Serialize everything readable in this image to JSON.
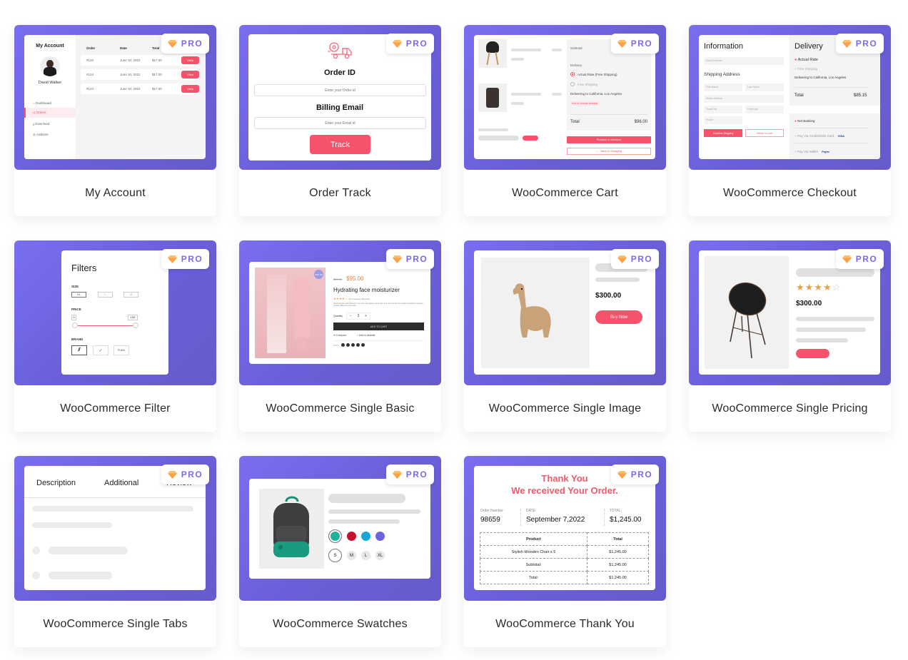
{
  "badge_label": "PRO",
  "colors": {
    "accent": "#7b6be8",
    "thumb_bg": "#7066e0",
    "red": "#f5526b",
    "star": "#e5a04a"
  },
  "cards": [
    {
      "title": "My Account",
      "preview": {
        "heading": "My Account",
        "user_name": "David Walker",
        "menu": [
          "Dashboard",
          "Orders",
          "Download",
          "Address"
        ],
        "active_menu": "Orders",
        "columns": [
          "Order",
          "Date",
          "Total"
        ],
        "rows": [
          {
            "order": "#126",
            "date": "June 10, 2022",
            "total": "$17.00",
            "action": "View"
          },
          {
            "order": "#124",
            "date": "June 10, 2022",
            "total": "$17.00",
            "action": "View"
          },
          {
            "order": "#123",
            "date": "June 10, 2022",
            "total": "$17.00",
            "action": "View"
          }
        ]
      }
    },
    {
      "title": "Order Track",
      "preview": {
        "order_label": "Order ID",
        "order_placeholder": "Enter your Order id",
        "email_label": "Billing Email",
        "email_placeholder": "Enter your Email id",
        "button": "Track"
      }
    },
    {
      "title": "WooCommerce Cart",
      "preview": {
        "subtotal_label": "Subtotal",
        "delivery_label": "Delivery",
        "options": [
          "Actual Rate (Free Shipping)",
          "Free Shipping"
        ],
        "selected_option": "Actual Rate (Free Shipping)",
        "delivering": "Delivering to California, Los Angeles",
        "change_address": "Add or change address",
        "total_label": "Total",
        "total_value": "$96.00",
        "checkout_button": "Proceed to checkout",
        "back_button": "Back to Shopping"
      }
    },
    {
      "title": "WooCommerce Checkout",
      "preview": {
        "info_heading": "Information",
        "email_placeholder": "Email Address",
        "shipping_heading": "Shipping Address",
        "first_name": "First Name",
        "last_name": "Last Name",
        "street": "Street Address",
        "town": "Town/City",
        "postcode": "Postcode",
        "phone": "Phone",
        "continue_button": "Continue Shipping",
        "return_button": "Return to Cart",
        "delivery_heading": "Delivery",
        "rate_options": [
          "Actual Rate",
          "Free Shipping"
        ],
        "delivering": "Delivering to California, Los Angeles",
        "total_label": "Total",
        "total_value": "$85.15",
        "payment_options": [
          "Net Banking",
          "Pay Via Credit/Debit Card",
          "Pay Via Wallet"
        ],
        "card_brand": "VISA",
        "wallet_brand": "Paytm"
      }
    },
    {
      "title": "WooCommerce Filter",
      "preview": {
        "heading": "Filters",
        "size_label": "SIZE",
        "sizes": [
          "XL",
          "L",
          "M"
        ],
        "price_label": "PRICE",
        "price_min": "0",
        "price_max": "100",
        "brand_label": "BRAND",
        "brands": [
          "adidas",
          "nike",
          "puma"
        ]
      }
    },
    {
      "title": "WooCommerce Single Basic",
      "preview": {
        "sale_badge": "20% Off",
        "old_price": "$90.00",
        "price": "$95.00",
        "name": "Hydrating face moisturizer",
        "rating": 4.5,
        "reviews": "(0) Customer Reviews",
        "description": "Niacinamide and Vitamin C are two anti-aging superstars but not usually formulated together because of their different pH levels.",
        "quantity_label": "Quantity",
        "quantity": "3",
        "add_to_cart": "ADD TO CART",
        "compare": "Compare",
        "wishlist": "Add to wishlist",
        "share": "Share:"
      }
    },
    {
      "title": "WooCommerce Single Image",
      "preview": {
        "price": "$300.00",
        "button": "Buy Now"
      }
    },
    {
      "title": "WooCommerce Single Pricing",
      "preview": {
        "price": "$300.00",
        "rating": 4,
        "rating_max": 5
      }
    },
    {
      "title": "WooCommerce Single Tabs",
      "preview": {
        "tabs": [
          "Description",
          "Additional",
          "Review"
        ],
        "active_tab": "Description"
      }
    },
    {
      "title": "WooCommerce Swatches",
      "preview": {
        "colors": [
          "#1fb49a",
          "#c8102e",
          "#1aa6d2",
          "#6b63e0"
        ],
        "selected_color": "#1fb49a",
        "sizes": [
          "S",
          "M",
          "L",
          "XL"
        ],
        "selected_size": "S"
      }
    },
    {
      "title": "WooCommerce Thank You",
      "preview": {
        "line1": "Thank You",
        "line2": "We received Your Order.",
        "order_number_label": "Order Number",
        "order_number": "98659",
        "date_label": "DATE:",
        "date": "September 7,2022",
        "total_label": "TOTAL:",
        "total": "$1,245.00",
        "table_headers": [
          "Product",
          "Total"
        ],
        "table_rows": [
          [
            "Stylish Wooden Chair x 5",
            "$1,245.00"
          ],
          [
            "Subtotal:",
            "$1,245.00"
          ],
          [
            "Total:",
            "$1,245.00"
          ]
        ]
      }
    }
  ]
}
